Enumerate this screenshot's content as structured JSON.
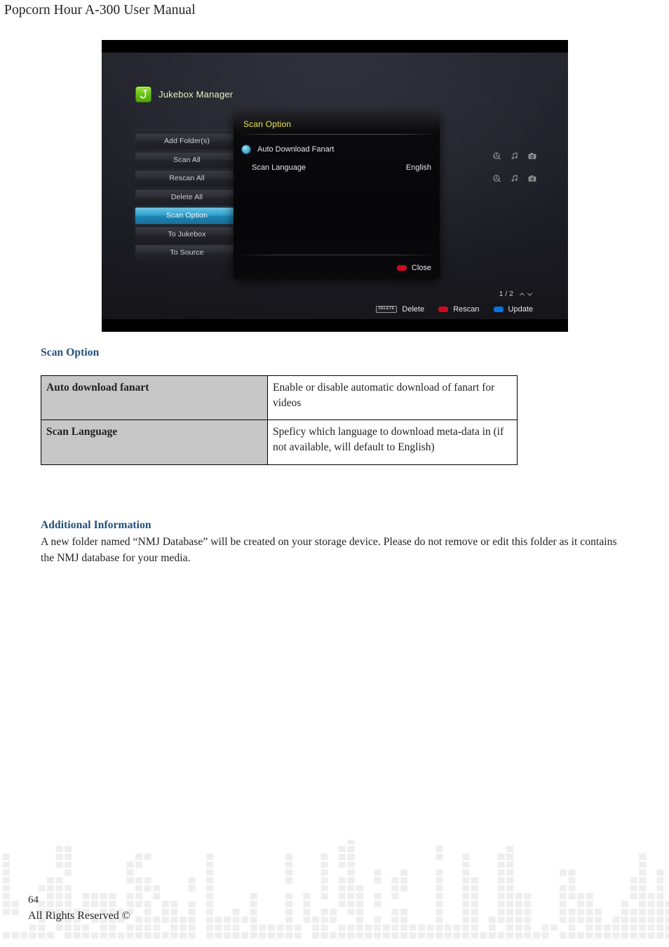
{
  "page": {
    "header_title": "Popcorn Hour A-300 User Manual",
    "page_number": "64",
    "rights": "All Rights Reserved ©"
  },
  "figure": {
    "brand": {
      "logo_letter": "J",
      "title": "Jukebox Manager"
    },
    "menu_items": [
      {
        "label": "Add Folder(s)",
        "selected": false
      },
      {
        "label": "Scan All",
        "selected": false
      },
      {
        "label": "Rescan All",
        "selected": false
      },
      {
        "label": "Delete All",
        "selected": false
      },
      {
        "label": "Scan Option",
        "selected": true
      },
      {
        "label": "To Jukebox",
        "selected": false
      },
      {
        "label": "To Source",
        "selected": false
      }
    ],
    "dialog": {
      "title": "Scan Option",
      "fanart_label": "Auto Download Fanart",
      "language_label": "Scan Language",
      "language_value": "English",
      "close_label": "Close"
    },
    "media_icons": [
      [
        "film-disc-icon",
        "music-note-icon",
        "camera-icon"
      ],
      [
        "film-disc-icon",
        "music-note-icon",
        "camera-icon"
      ]
    ],
    "status_bar": {
      "pager": "1 / 2",
      "delete_key": "DELETE",
      "delete_label": "Delete",
      "rescan_label": "Rescan",
      "update_label": "Update"
    },
    "colors": {
      "dialog_title": "#e8e84a",
      "brand_title": "#e9f2bd",
      "selected_menu": "#2f9fcb",
      "rescan_swatch": "#cc0a22",
      "update_swatch": "#0a74dd",
      "radio_dot": "#56b9dd"
    }
  },
  "content": {
    "scan_option_heading": "Scan Option",
    "table": {
      "rows": [
        {
          "term": "Auto download fanart",
          "desc": "Enable or disable automatic download of fanart for videos"
        },
        {
          "term": "Scan Language",
          "desc": "Speficy which language to download meta-data in (if not available, will default to English)"
        }
      ]
    },
    "additional_heading": "Additional Information",
    "additional_text": "A new folder named “NMJ Database” will be created on your storage device. Please do not remove or edit this folder as it contains the NMJ database for your media."
  },
  "theme": {
    "heading_blue": "#1f4e79",
    "table_term_bg": "#c7c7c7",
    "text_black": "#231f20"
  }
}
